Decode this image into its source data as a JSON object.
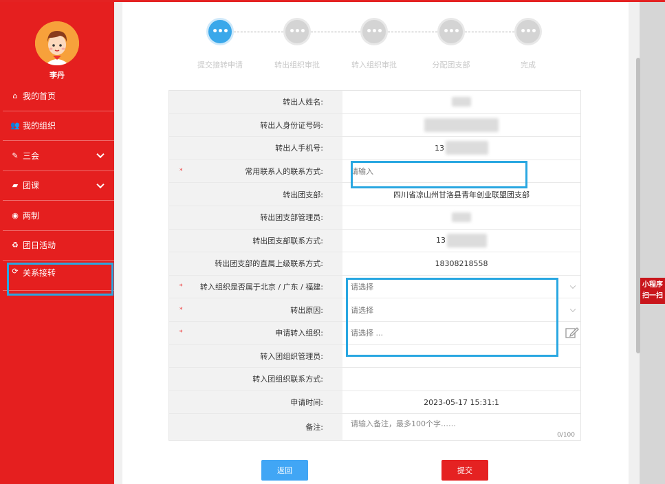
{
  "user": {
    "name": "李丹"
  },
  "sidebar": {
    "items": [
      {
        "label": "我的首页",
        "icon": "home-icon",
        "glyph": "⌂"
      },
      {
        "label": "我的组织",
        "icon": "users-icon",
        "glyph": "👥"
      },
      {
        "label": "三会",
        "icon": "edit-icon",
        "glyph": "✎"
      },
      {
        "label": "团课",
        "icon": "folder-icon",
        "glyph": "▰"
      },
      {
        "label": "两制",
        "icon": "target-icon",
        "glyph": "◉"
      },
      {
        "label": "团日活动",
        "icon": "recycle-icon",
        "glyph": "♻"
      },
      {
        "label": "关系接转",
        "icon": "refresh-icon",
        "glyph": "⟳"
      }
    ]
  },
  "steps": [
    {
      "label": "提交接转申请",
      "icon_text": "•••"
    },
    {
      "label": "转出组织审批",
      "icon_text": "•••"
    },
    {
      "label": "转入组织审批",
      "icon_text": "•••"
    },
    {
      "label": "分配团支部",
      "icon_text": "•••"
    },
    {
      "label": "完成",
      "icon_text": "•••"
    }
  ],
  "form": {
    "rows": [
      {
        "label": "转出人姓名:",
        "value": ""
      },
      {
        "label": "转出人身份证号码:",
        "value": ""
      },
      {
        "label": "转出人手机号:",
        "value": "13"
      },
      {
        "label": "常用联系人的联系方式:",
        "placeholder": "请输入",
        "required_mark": "*"
      },
      {
        "label": "转出团支部:",
        "value": "四川省凉山州甘洛县青年创业联盟团支部"
      },
      {
        "label": "转出团支部管理员:",
        "value": ""
      },
      {
        "label": "转出团支部联系方式:",
        "value": "13"
      },
      {
        "label": "转出团支部的直属上级联系方式:",
        "value": "18308218558"
      },
      {
        "label": "转入组织是否属于北京 / 广东 / 福建:",
        "placeholder": "请选择",
        "required_mark": "*"
      },
      {
        "label": "转出原因:",
        "placeholder": "请选择",
        "required_mark": "*"
      },
      {
        "label": "申请转入组织:",
        "placeholder": "请选择 ...",
        "required_mark": "*"
      },
      {
        "label": "转入团组织管理员:",
        "value": ""
      },
      {
        "label": "转入团组织联系方式:",
        "value": ""
      },
      {
        "label": "申请时间:",
        "value": "2023-05-17 15:31:1"
      },
      {
        "label": "备注:",
        "placeholder": "请输入备注，最多100个字……",
        "counter": "0/100"
      }
    ]
  },
  "buttons": {
    "back": "返回",
    "submit": "提交"
  },
  "side_tag": {
    "line1": "小程序",
    "line2": "扫一扫"
  },
  "colors": {
    "brand_red": "#e51f1f",
    "highlight_blue": "#29a7e1",
    "step_active": "#3aa8ea"
  }
}
